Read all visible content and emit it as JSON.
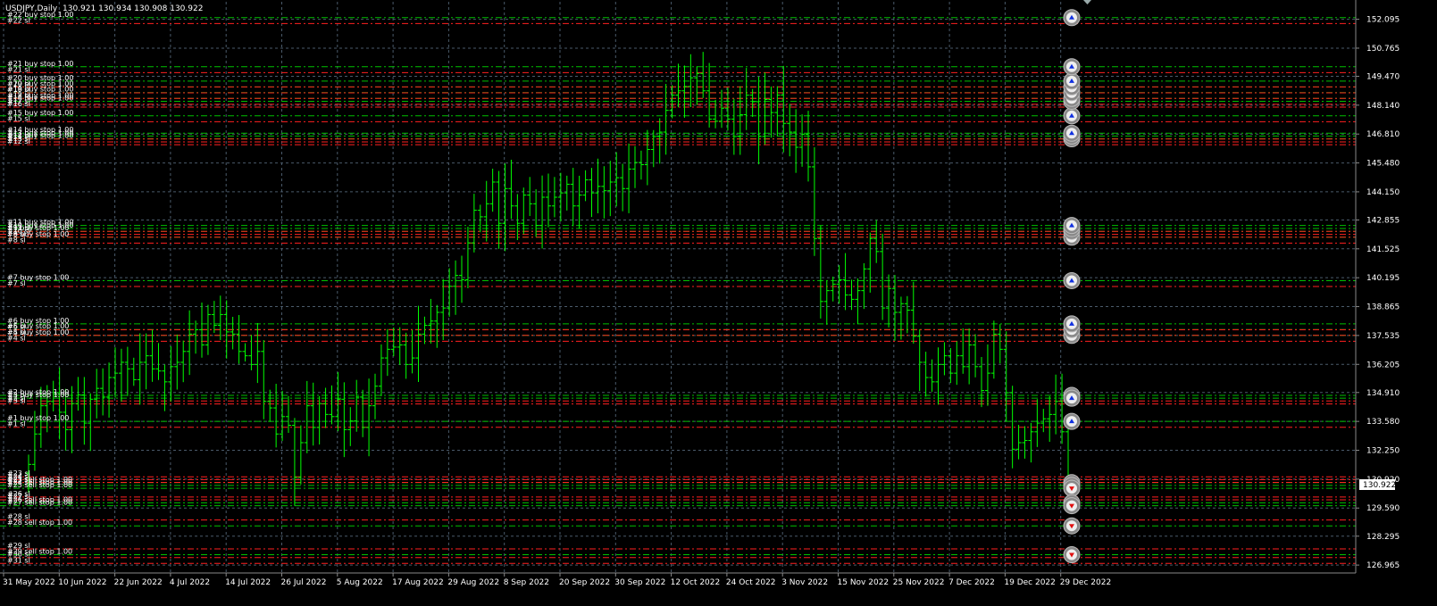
{
  "header": {
    "symbol": "USDJPY,Daily",
    "ohlc": "130.921 130.934 130.908 130.922"
  },
  "current_price_label": "130.922",
  "chart_data": {
    "type": "bar",
    "title": "USDJPY,Daily",
    "ylim": [
      126.6,
      152.9
    ],
    "grid": true,
    "y_ticks": [
      "152.095",
      "150.765",
      "149.470",
      "148.140",
      "146.810",
      "145.480",
      "144.150",
      "142.855",
      "141.525",
      "140.195",
      "138.865",
      "137.535",
      "136.205",
      "134.910",
      "133.580",
      "132.250",
      "130.920",
      "129.590",
      "128.295",
      "126.965"
    ],
    "x_ticks": [
      "31 May 2022",
      "10 Jun 2022",
      "22 Jun 2022",
      "4 Jul 2022",
      "14 Jul 2022",
      "26 Jul 2022",
      "5 Aug 2022",
      "17 Aug 2022",
      "29 Aug 2022",
      "8 Sep 2022",
      "20 Sep 2022",
      "30 Sep 2022",
      "12 Oct 2022",
      "24 Oct 2022",
      "3 Nov 2022",
      "15 Nov 2022",
      "25 Nov 2022",
      "7 Dec 2022",
      "19 Dec 2022",
      "29 Dec 2022"
    ],
    "closes": [
      131.6,
      133.0,
      134.3,
      134.5,
      134.9,
      134.0,
      133.2,
      134.4,
      134.8,
      133.5,
      134.6,
      135.1,
      134.7,
      135.6,
      135.8,
      136.3,
      136.0,
      135.5,
      136.3,
      136.6,
      136.0,
      135.9,
      135.4,
      136.1,
      136.3,
      136.8,
      137.6,
      137.8,
      137.1,
      138.5,
      138.0,
      138.5,
      137.7,
      137.6,
      136.8,
      136.6,
      136.2,
      136.8,
      134.5,
      134.2,
      133.0,
      133.8,
      133.4,
      131.0,
      132.6,
      134.3,
      133.3,
      134.4,
      133.9,
      133.8,
      134.6,
      133.2,
      133.6,
      134.7,
      133.3,
      134.3,
      135.2,
      136.5,
      136.9,
      137.0,
      137.1,
      136.2,
      136.5,
      137.6,
      138.0,
      138.2,
      138.6,
      138.8,
      139.8,
      140.3,
      140.1,
      141.8,
      143.3,
      143.0,
      143.6,
      144.6,
      142.7,
      144.3,
      143.5,
      142.7,
      144.0,
      143.6,
      142.6,
      143.9,
      143.5,
      143.9,
      144.1,
      144.5,
      143.5,
      144.0,
      144.7,
      144.1,
      144.4,
      144.2,
      144.6,
      144.8,
      144.3,
      145.2,
      145.5,
      145.4,
      146.1,
      146.7,
      146.9,
      147.9,
      148.6,
      148.8,
      149.0,
      149.4,
      149.6,
      148.8,
      147.5,
      147.4,
      148.0,
      147.5,
      146.7,
      147.7,
      148.6,
      148.3,
      146.7,
      148.4,
      147.8,
      148.6,
      147.3,
      146.9,
      146.2,
      146.8,
      145.3,
      142.0,
      139.1,
      139.6,
      139.9,
      140.1,
      139.4,
      139.2,
      139.6,
      140.6,
      142.0,
      141.4,
      138.8,
      139.7,
      138.6,
      139.0,
      138.7,
      137.5,
      136.3,
      135.6,
      135.4,
      136.2,
      136.6,
      135.8,
      136.6,
      136.1,
      137.1,
      136.1,
      135.0,
      135.8,
      137.6,
      136.9,
      134.9,
      132.3,
      132.6,
      132.7,
      133.1,
      133.5,
      133.7,
      133.9,
      134.5,
      133.1,
      130.9
    ],
    "orders": [
      {
        "label": "#1 buy stop 1.00",
        "price": 133.58
      },
      {
        "label": "#1 sl",
        "price": 133.31
      },
      {
        "label": "#2 buy stop 1.00",
        "price": 134.78
      },
      {
        "label": "#2 sl",
        "price": 134.52
      },
      {
        "label": "#3 buy stop 1.00",
        "price": 134.65
      },
      {
        "label": "#3 sl",
        "price": 134.38
      },
      {
        "label": "#4 buy stop 1.00",
        "price": 137.54
      },
      {
        "label": "#4 sl",
        "price": 137.27
      },
      {
        "label": "#5 buy stop 1.00",
        "price": 137.81
      },
      {
        "label": "#5 sl",
        "price": 137.54
      },
      {
        "label": "#6 buy stop 1.00",
        "price": 138.07
      },
      {
        "label": "#6 sl",
        "price": 137.8
      },
      {
        "label": "#7 buy stop 1.00",
        "price": 140.06
      },
      {
        "label": "#7 sl",
        "price": 139.79
      },
      {
        "label": "#8 buy stop 1.00",
        "price": 142.06
      },
      {
        "label": "#8 sl",
        "price": 141.79
      },
      {
        "label": "#9 buy stop 1.00",
        "price": 142.33
      },
      {
        "label": "#9 sl",
        "price": 142.06
      },
      {
        "label": "#10 buy stop 1.00",
        "price": 142.46
      },
      {
        "label": "#10 sl",
        "price": 142.19
      },
      {
        "label": "#11 buy stop 1.00",
        "price": 142.6
      },
      {
        "label": "#11 sl",
        "price": 142.33
      },
      {
        "label": "#12 buy stop 1.00",
        "price": 146.59
      },
      {
        "label": "#12 sl",
        "price": 146.32
      },
      {
        "label": "#13 buy stop 1.00",
        "price": 146.72
      },
      {
        "label": "#13 sl",
        "price": 146.45
      },
      {
        "label": "#14 buy stop 1.00",
        "price": 146.85
      },
      {
        "label": "#14 sl",
        "price": 146.58
      },
      {
        "label": "#15 buy stop 1.00",
        "price": 147.65
      },
      {
        "label": "#15 sl",
        "price": 147.38
      },
      {
        "label": "#16 buy stop 1.00",
        "price": 148.32
      },
      {
        "label": "#16 sl",
        "price": 148.05
      },
      {
        "label": "#17 buy stop 1.00",
        "price": 148.45
      },
      {
        "label": "#17 sl",
        "price": 148.18
      },
      {
        "label": "#18 buy stop 1.00",
        "price": 148.72
      },
      {
        "label": "#18 sl",
        "price": 148.45
      },
      {
        "label": "#19 buy stop 1.00",
        "price": 148.98
      },
      {
        "label": "#19 sl",
        "price": 148.71
      },
      {
        "label": "#20 buy stop 1.00",
        "price": 149.25
      },
      {
        "label": "#20 sl",
        "price": 148.98
      },
      {
        "label": "#21 buy stop 1.00",
        "price": 149.91
      },
      {
        "label": "#21 sl",
        "price": 149.64
      },
      {
        "label": "#22 buy stop 1.00",
        "price": 152.17
      },
      {
        "label": "#22 sl",
        "price": 151.9
      },
      {
        "label": "#23 sell stop 1.00",
        "price": 130.76
      },
      {
        "label": "#23 sl",
        "price": 131.03
      },
      {
        "label": "#24 sell stop 1.00",
        "price": 130.63
      },
      {
        "label": "#24 sl",
        "price": 130.9
      },
      {
        "label": "#25 sell stop 1.00",
        "price": 130.5
      },
      {
        "label": "#25 sl",
        "price": 130.77
      },
      {
        "label": "#26 sell stop 1.00",
        "price": 129.83
      },
      {
        "label": "#26 sl",
        "price": 130.1
      },
      {
        "label": "#27 sell stop 1.00",
        "price": 129.7
      },
      {
        "label": "#27 sl",
        "price": 129.97
      },
      {
        "label": "#28 sell stop 1.00",
        "price": 128.77
      },
      {
        "label": "#28 sl",
        "price": 129.04
      },
      {
        "label": "#29 sell stop 1.00",
        "price": 127.44
      },
      {
        "label": "#29 sl",
        "price": 127.71
      },
      {
        "label": "#30 sl",
        "price": 127.31
      },
      {
        "label": "#31 sl",
        "price": 127.04
      }
    ]
  },
  "colors": {
    "background": "#000000",
    "bars": "#00ff00",
    "grid": "#4a5a6a",
    "sl": "#ff2020",
    "entry": "#00c000",
    "axis_text": "#ffffff"
  }
}
